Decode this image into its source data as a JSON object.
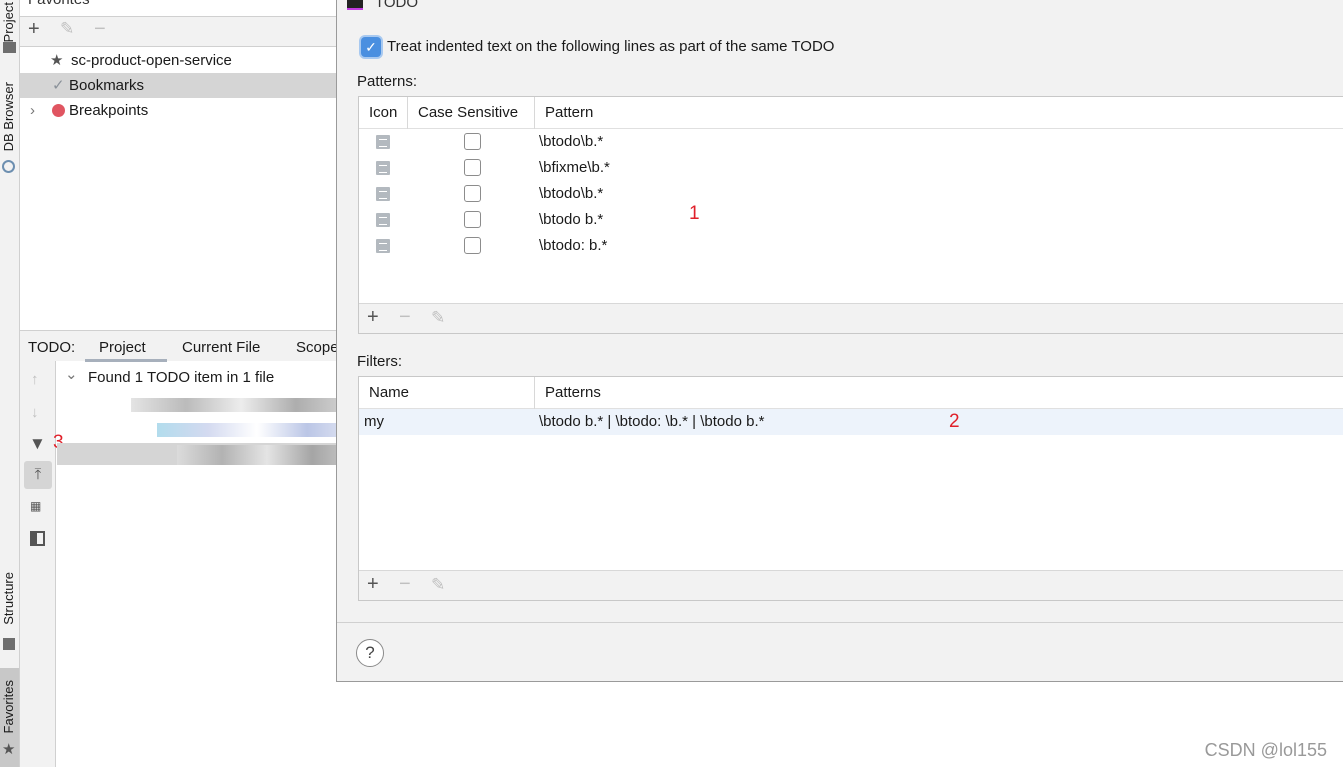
{
  "side_strip": {
    "top_tabs": [
      "Project",
      "DB Browser"
    ],
    "bottom_tabs": [
      "Structure",
      "Favorites"
    ]
  },
  "favorites": {
    "title": "Favorites",
    "items": [
      {
        "label": "sc-product-open-service",
        "icon": "star-icon"
      },
      {
        "label": "Bookmarks",
        "icon": "check-icon"
      },
      {
        "label": "Breakpoints",
        "icon": "breakpoint-dot-icon"
      }
    ]
  },
  "todo": {
    "label": "TODO:",
    "tabs": [
      "Project",
      "Current File",
      "Scope"
    ],
    "active_tab": "Project",
    "summary": "Found 1 TODO item in 1 file",
    "annotation": "3"
  },
  "dialog": {
    "title": "TODO",
    "treat_indented": "Treat indented text on the following lines as part of the same TODO",
    "treat_indented_checked": true,
    "patterns_label": "Patterns:",
    "patterns_columns": [
      "Icon",
      "Case Sensitive",
      "Pattern"
    ],
    "patterns": [
      "\\btodo\\b.*",
      "\\bfixme\\b.*",
      "\\btodo\\b.*",
      "\\btodo b.*",
      "\\btodo: b.*"
    ],
    "patterns_annotation": "1",
    "filters_label": "Filters:",
    "filters_columns": [
      "Name",
      "Patterns"
    ],
    "filters": [
      {
        "name": "my",
        "patterns": "\\btodo b.* | \\btodo: \\b.* | \\btodo b.*"
      }
    ],
    "filters_annotation": "2",
    "help": "?"
  },
  "watermark": "CSDN @lol155",
  "colors": {
    "accent": "#4a8fe0",
    "selection": "#d5d5d5",
    "filter_selection": "#edf3fb",
    "annotation": "#e0202a"
  }
}
